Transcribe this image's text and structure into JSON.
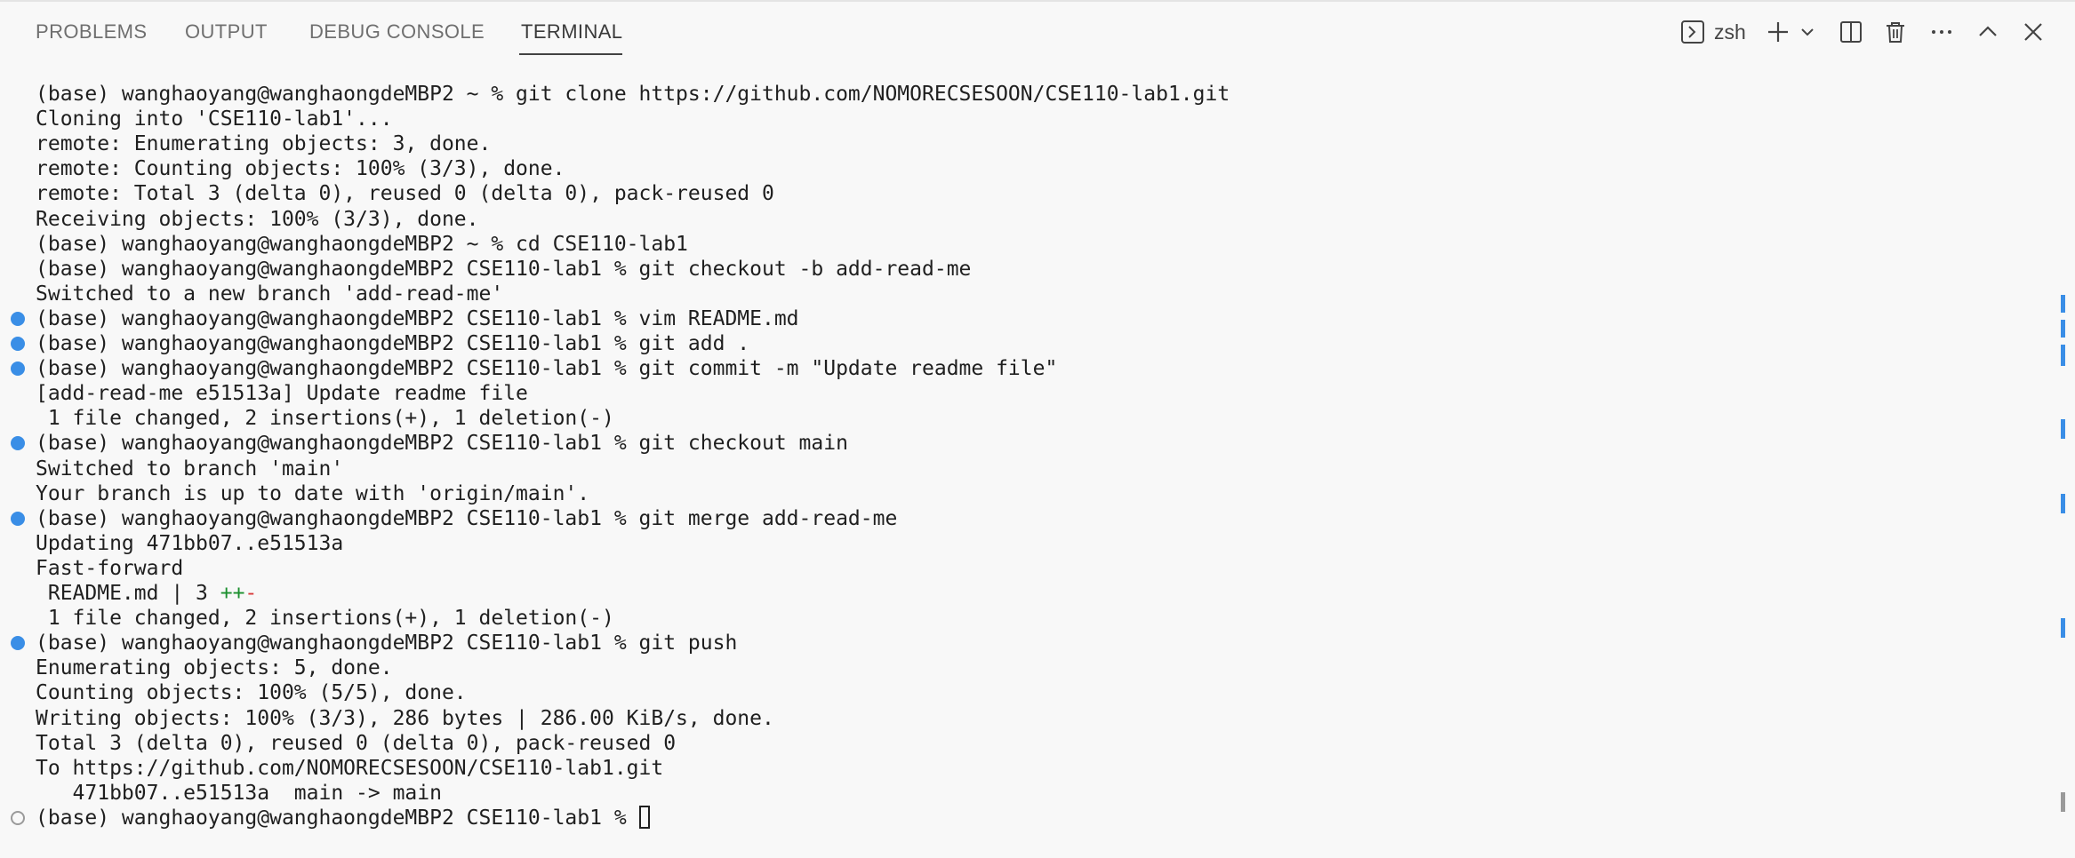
{
  "panel": {
    "tabs": [
      {
        "label": "PROBLEMS",
        "active": false
      },
      {
        "label": "OUTPUT",
        "active": false
      },
      {
        "label": "DEBUG CONSOLE",
        "active": false
      },
      {
        "label": "TERMINAL",
        "active": true
      }
    ],
    "actions": {
      "shell_name": "zsh",
      "items": [
        "terminal-icon",
        "plus-icon",
        "chevron-down-icon",
        "split-icon",
        "trash-icon",
        "more-icon",
        "chevron-up-icon",
        "close-icon"
      ]
    }
  },
  "terminal": {
    "prompt_home": "(base) wanghaoyang@wanghaongdeMBP2 ~ % ",
    "prompt_repo": "(base) wanghaoyang@wanghaongdeMBP2 CSE110-lab1 % ",
    "lines": [
      "(base) wanghaoyang@wanghaongdeMBP2 ~ % git clone https://github.com/NOMORECSESOON/CSE110-lab1.git",
      "Cloning into 'CSE110-lab1'...",
      "remote: Enumerating objects: 3, done.",
      "remote: Counting objects: 100% (3/3), done.",
      "remote: Total 3 (delta 0), reused 0 (delta 0), pack-reused 0",
      "Receiving objects: 100% (3/3), done.",
      "(base) wanghaoyang@wanghaongdeMBP2 ~ % cd CSE110-lab1",
      "(base) wanghaoyang@wanghaongdeMBP2 CSE110-lab1 % git checkout -b add-read-me",
      "Switched to a new branch 'add-read-me'",
      "(base) wanghaoyang@wanghaongdeMBP2 CSE110-lab1 % vim README.md",
      "(base) wanghaoyang@wanghaongdeMBP2 CSE110-lab1 % git add .",
      "(base) wanghaoyang@wanghaongdeMBP2 CSE110-lab1 % git commit -m \"Update readme file\"",
      "[add-read-me e51513a] Update readme file",
      " 1 file changed, 2 insertions(+), 1 deletion(-)",
      "(base) wanghaoyang@wanghaongdeMBP2 CSE110-lab1 % git checkout main",
      "Switched to branch 'main'",
      "Your branch is up to date with 'origin/main'.",
      "(base) wanghaoyang@wanghaongdeMBP2 CSE110-lab1 % git merge add-read-me",
      "Updating 471bb07..e51513a",
      "Fast-forward",
      "__DIFFSTAT__",
      " 1 file changed, 2 insertions(+), 1 deletion(-)",
      "(base) wanghaoyang@wanghaongdeMBP2 CSE110-lab1 % git push",
      "Enumerating objects: 5, done.",
      "Counting objects: 100% (5/5), done.",
      "Writing objects: 100% (3/3), 286 bytes | 286.00 KiB/s, done.",
      "Total 3 (delta 0), reused 0 (delta 0), pack-reused 0",
      "To https://github.com/NOMORECSESOON/CSE110-lab1.git",
      "   471bb07..e51513a  main -> main",
      "(base) wanghaoyang@wanghaongdeMBP2 CSE110-lab1 % "
    ],
    "diffstat": {
      "prefix": " README.md | 3 ",
      "plus": "++",
      "minus": "-"
    },
    "command_markers": [
      {
        "line": 9,
        "status": "done"
      },
      {
        "line": 10,
        "status": "done"
      },
      {
        "line": 11,
        "status": "done"
      },
      {
        "line": 14,
        "status": "done"
      },
      {
        "line": 17,
        "status": "done"
      },
      {
        "line": 22,
        "status": "done"
      },
      {
        "line": 29,
        "status": "pending"
      }
    ],
    "cursor_line": 29
  },
  "colors": {
    "background": "#f8f8f8",
    "text": "#1f1f1f",
    "tab_inactive": "#6f6f6f",
    "success_dot": "#3a8ee6",
    "diff_add": "#1b8f2e",
    "diff_del": "#d73a3a"
  }
}
